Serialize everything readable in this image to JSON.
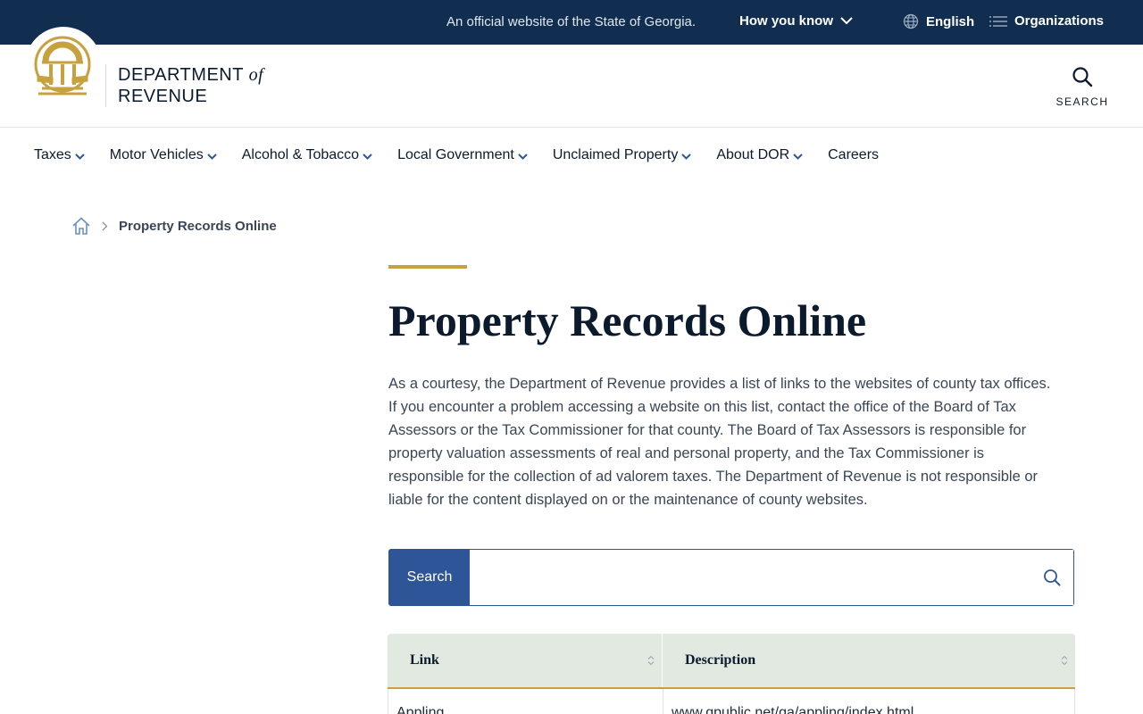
{
  "banner": {
    "official_text": "An official website of the State of Georgia.",
    "how_you_know": "How you know",
    "language": "English",
    "organizations": "Organizations"
  },
  "header": {
    "logo_line1": "DEPARTMENT",
    "logo_of": "of",
    "logo_line2": "REVENUE",
    "search_label": "SEARCH"
  },
  "nav": [
    {
      "label": "Taxes",
      "has_menu": true
    },
    {
      "label": "Motor Vehicles",
      "has_menu": true
    },
    {
      "label": "Alcohol & Tobacco",
      "has_menu": true
    },
    {
      "label": "Local Government",
      "has_menu": true
    },
    {
      "label": "Unclaimed Property",
      "has_menu": true
    },
    {
      "label": "About DOR",
      "has_menu": true
    },
    {
      "label": "Careers",
      "has_menu": false
    }
  ],
  "breadcrumb": {
    "current": "Property Records Online"
  },
  "content": {
    "title": "Property Records Online",
    "intro": "As a courtesy, the Department of Revenue provides a list of links to the websites of county tax offices. If you encounter a problem accessing a website on this list, contact the office of the Board of Tax Assessors or the Tax Commissioner for that county. The Board of Tax Assessors is responsible for property valuation assessments of real and personal property, and the Tax Commissioner is responsible for the collection of ad valorem taxes. The Department of Revenue is not responsible or liable for the content displayed on or the maintenance of county websites."
  },
  "search": {
    "label": "Search",
    "value": "",
    "placeholder": ""
  },
  "table": {
    "headers": [
      "Link",
      "Description"
    ],
    "rows": [
      {
        "link": "Appling",
        "description": "www.qpublic.net/ga/appling/index.html"
      }
    ]
  },
  "colors": {
    "banner_bg": "#112e51",
    "accent_gold": "#c8a13f",
    "search_blue": "#2e5597",
    "table_header_bg": "#e1e9e1"
  }
}
